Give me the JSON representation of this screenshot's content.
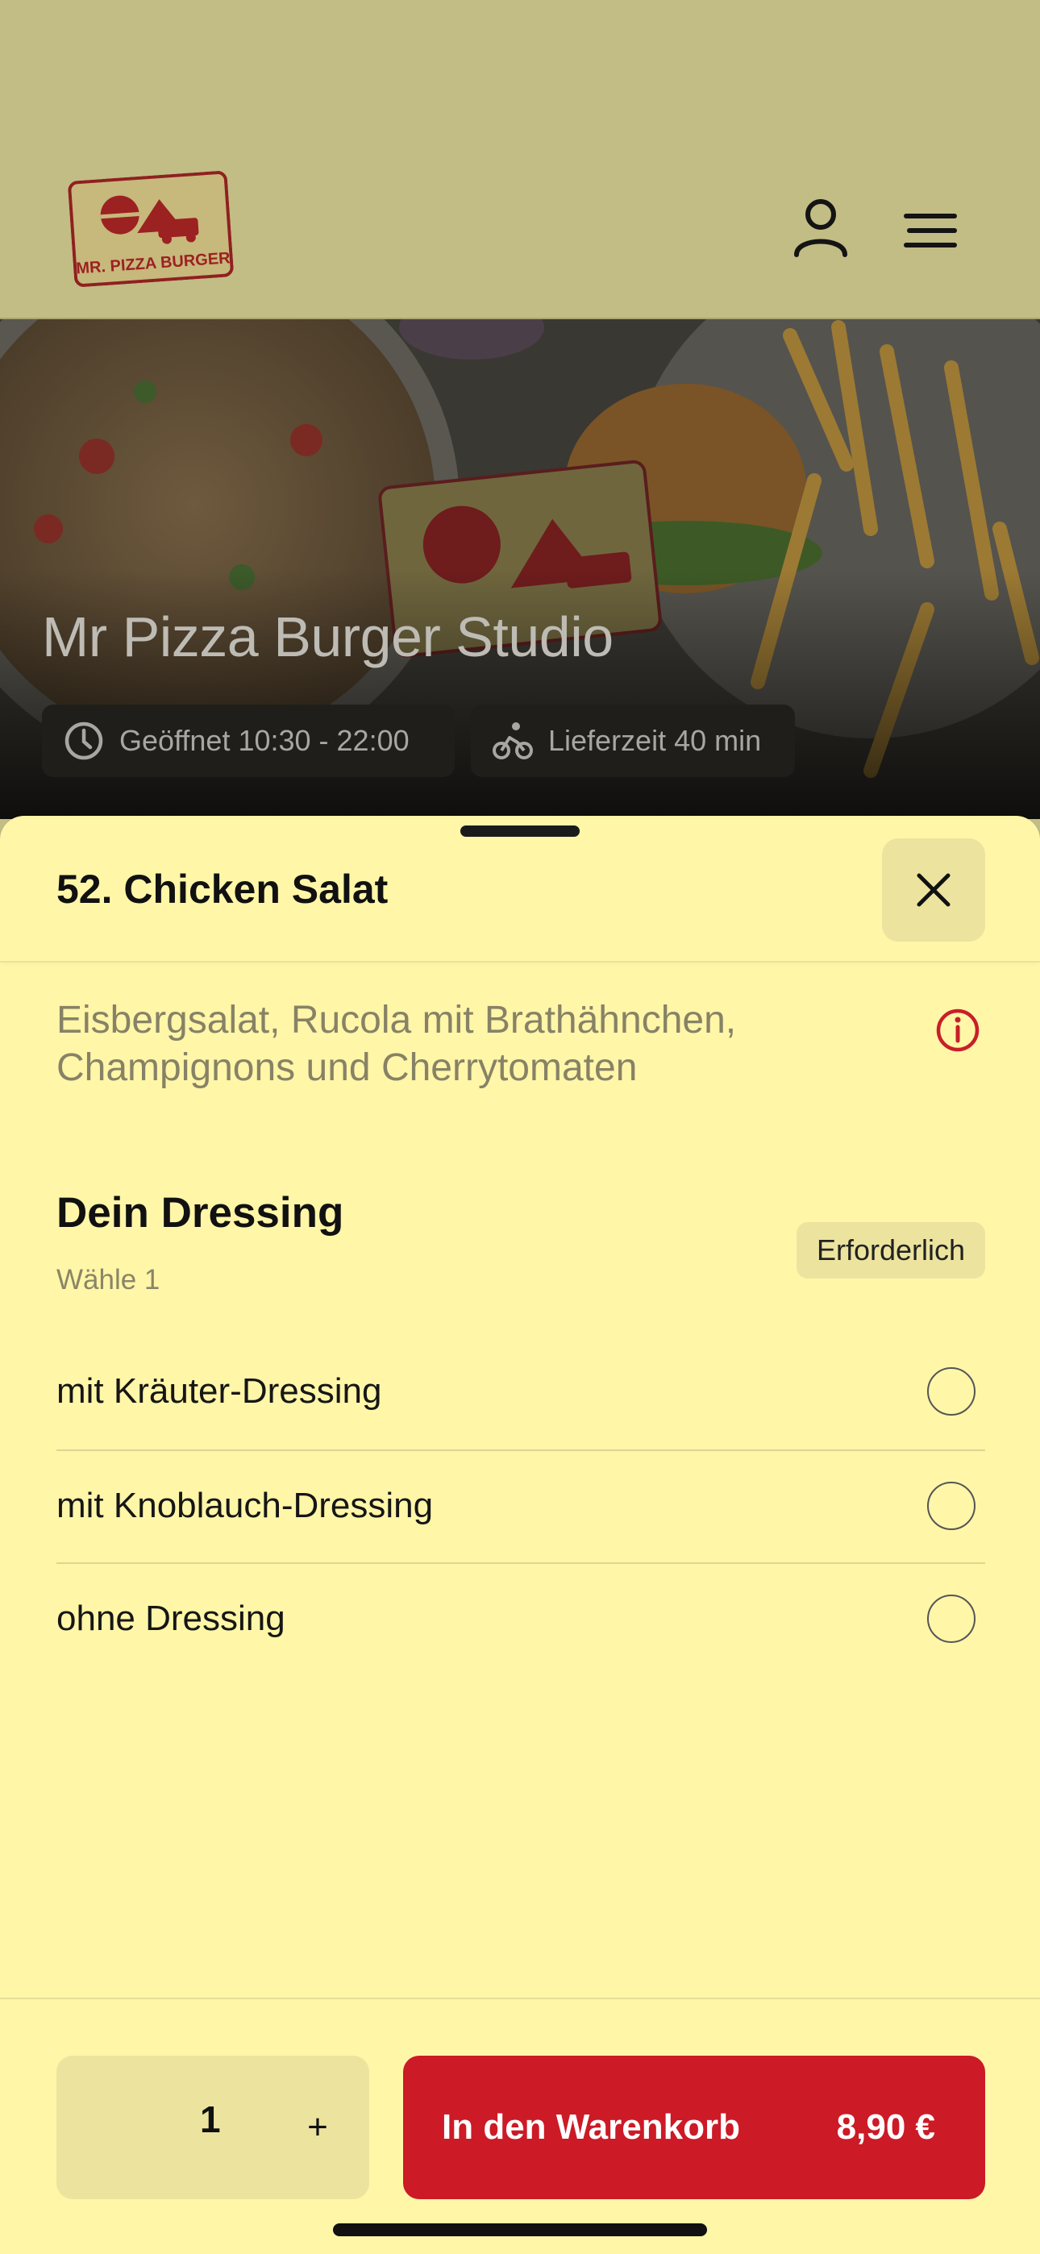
{
  "header": {
    "logo_text": "MR. PIZZA BURGER",
    "icons": [
      "user-icon",
      "menu-icon"
    ]
  },
  "hero": {
    "title": "Mr Pizza Burger Studio",
    "chips": {
      "open_hours": "Geöffnet 10:30 - 22:00",
      "delivery_time": "Lieferzeit 40 min"
    }
  },
  "sheet": {
    "item_title": "52. Chicken Salat",
    "description": "Eisbergsalat, Rucola mit Brathähnchen, Champignons und Cherrytomaten",
    "section": {
      "title": "Dein Dressing",
      "subtitle": "Wähle 1",
      "badge": "Erforderlich",
      "options": [
        {
          "label": "mit Kräuter-Dressing",
          "selected": false
        },
        {
          "label": "mit Knoblauch-Dressing",
          "selected": false
        },
        {
          "label": "ohne Dressing",
          "selected": false
        }
      ]
    },
    "footer": {
      "quantity": "1",
      "plus_label": "+",
      "cart_label": "In den Warenkorb",
      "price": "8,90 €"
    }
  },
  "colors": {
    "accent_red": "#cc1a26",
    "sheet_background": "#fff6a8",
    "dimmed_header": "#c1bd85"
  }
}
